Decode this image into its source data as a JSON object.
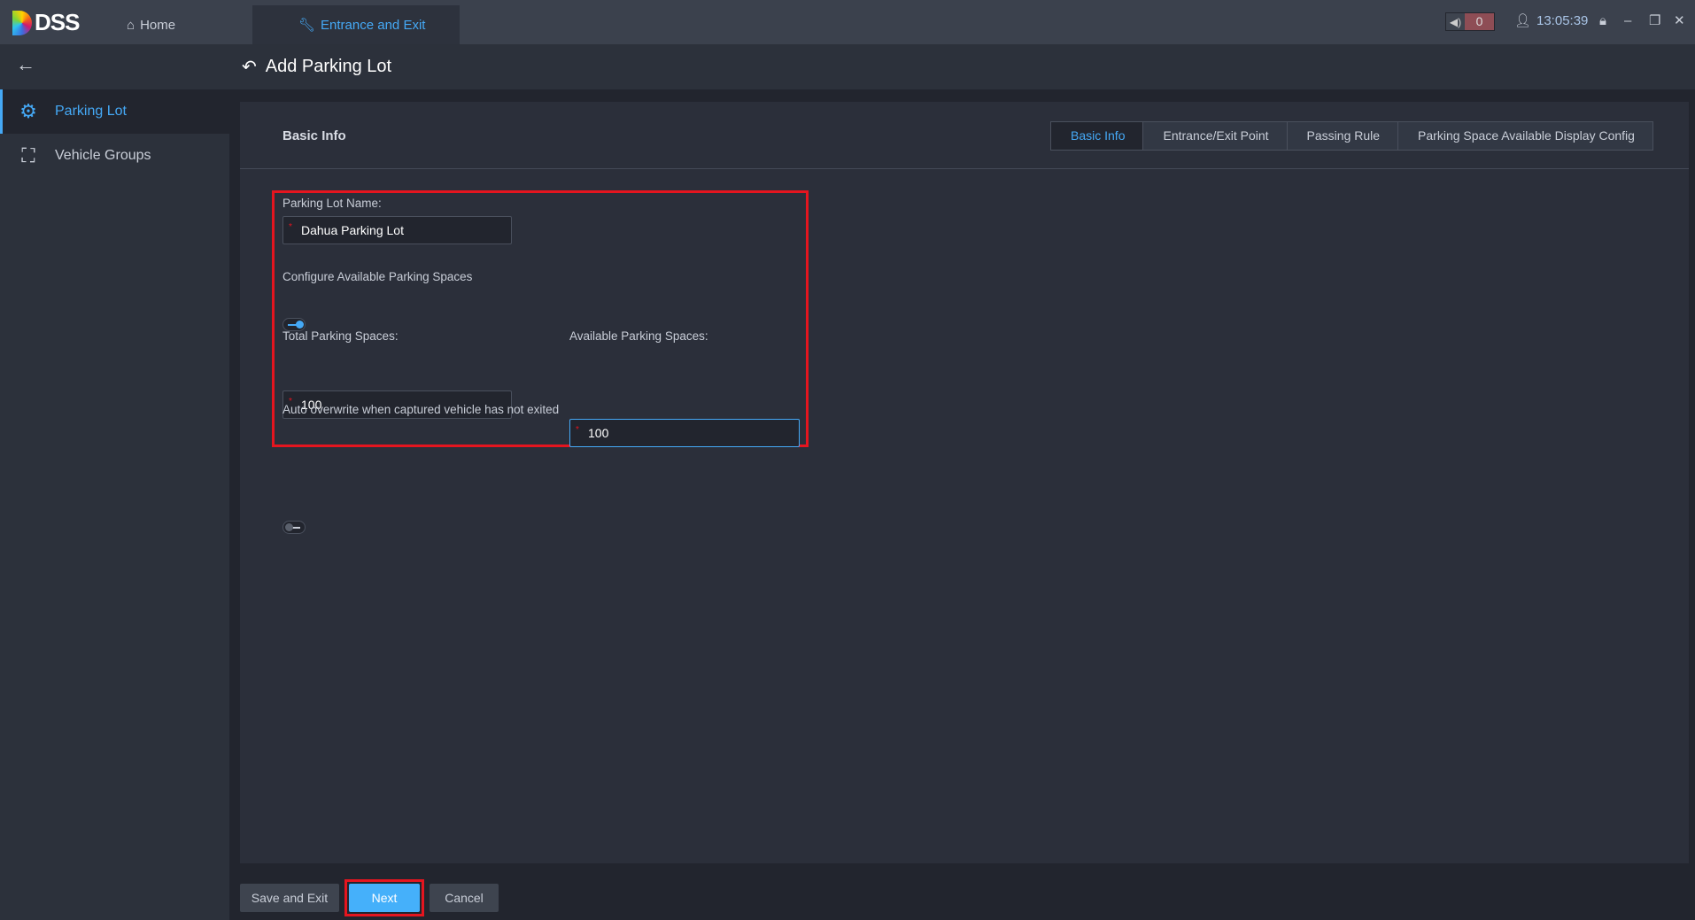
{
  "app": {
    "logo_text": "DSS",
    "tabs": [
      {
        "label": "Home",
        "icon": "home-icon"
      },
      {
        "label": "Entrance and Exit",
        "icon": "wrench-icon"
      }
    ],
    "alarm_count": "0",
    "time": "13:05:39"
  },
  "sidebar": {
    "items": [
      {
        "label": "Parking Lot",
        "icon": "parking-lot-icon",
        "active": true
      },
      {
        "label": "Vehicle Groups",
        "icon": "vehicle-groups-icon"
      }
    ]
  },
  "page": {
    "title": "Add Parking Lot"
  },
  "panel": {
    "title": "Basic Info",
    "steps": [
      "Basic Info",
      "Entrance/Exit Point",
      "Passing Rule",
      "Parking Space Available Display Config"
    ],
    "form": {
      "name_label": "Parking Lot Name:",
      "name_value": "Dahua Parking Lot",
      "configure_label": "Configure Available Parking Spaces",
      "configure_on": true,
      "total_label": "Total Parking Spaces:",
      "total_value": "100",
      "available_label": "Available Parking Spaces:",
      "available_value": "100",
      "auto_label": "Auto overwrite when captured vehicle has not exited",
      "auto_on": false
    }
  },
  "footer": {
    "save_exit": "Save and Exit",
    "next": "Next",
    "cancel": "Cancel"
  },
  "colors": {
    "accent": "#45a9f6",
    "highlight": "#e5151f"
  }
}
